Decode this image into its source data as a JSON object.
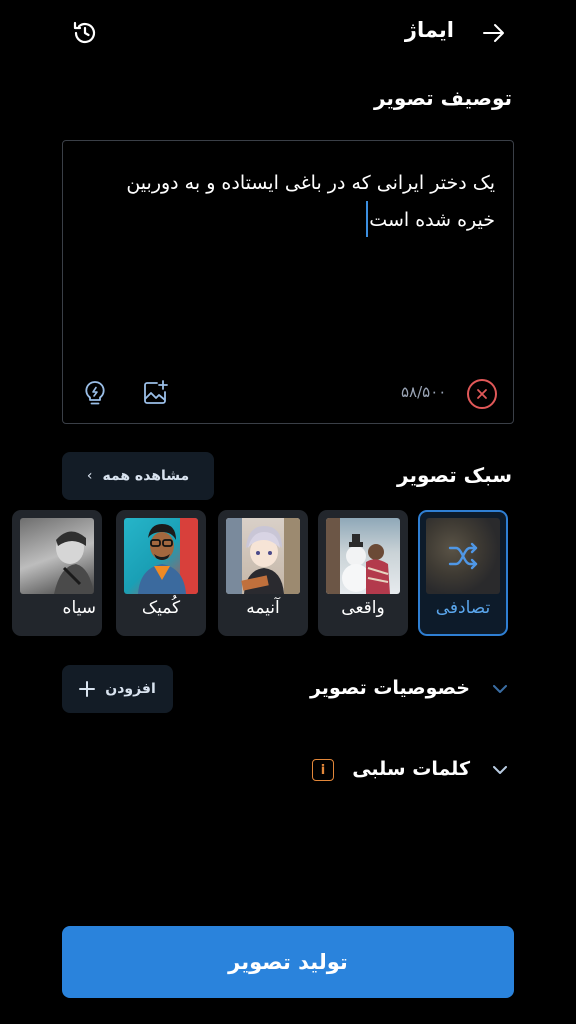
{
  "header": {
    "title": "ایماژ",
    "back_icon": "arrow-right-icon",
    "history_icon": "history-icon"
  },
  "prompt": {
    "section_title": "توصیف تصویر",
    "text": "یک دختر ایرانی که در باغی ایستاده و به دوربین خیره شده است",
    "char_count": "۵۸/۵۰۰",
    "tools": [
      "lightbulb-icon",
      "image-add-icon"
    ],
    "clear_icon": "close-icon"
  },
  "style": {
    "section_title": "سبک تصویر",
    "see_all_label": "مشاهده همه",
    "cards": [
      {
        "label": "تصادفی",
        "selected": true,
        "icon": "shuffle-icon"
      },
      {
        "label": "واقعی",
        "selected": false
      },
      {
        "label": "آنیمه",
        "selected": false
      },
      {
        "label": "کُمیک",
        "selected": false
      },
      {
        "label": "سیاه",
        "selected": false
      }
    ]
  },
  "features": {
    "title": "خصوصیات تصویر",
    "add_label": "افزودن"
  },
  "negative": {
    "title": "کلمات سلبی",
    "info_icon": "info-icon"
  },
  "generate": {
    "label": "تولید تصویر"
  },
  "colors": {
    "accent": "#2a83dc",
    "selected_border": "#2f7fd3",
    "clear": "#e05858",
    "info": "#e2873a"
  }
}
